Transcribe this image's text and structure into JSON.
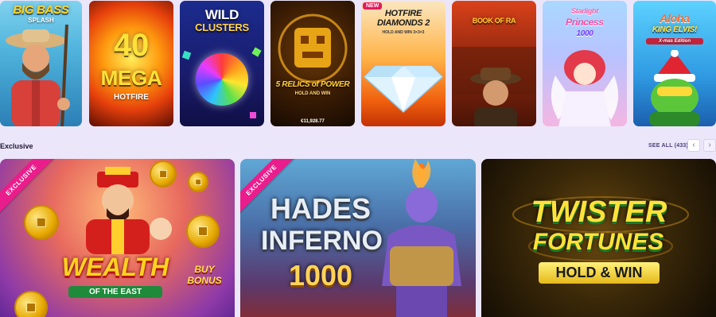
{
  "top_games": [
    {
      "title": "BIG BASS",
      "subtitle": "SPLASH",
      "icon": "fisherman-icon"
    },
    {
      "title": "40",
      "subtitle": "MEGA",
      "extra": "HOTFIRE",
      "icon": "fire-icon"
    },
    {
      "title": "WILD",
      "subtitle": "CLUSTERS",
      "icon": "color-wheel-icon"
    },
    {
      "title": "5 RELICS of POWER",
      "subtitle": "HOLD AND WIN",
      "jackpot": "€11,928.77",
      "icon": "idol-icon"
    },
    {
      "title": "HOTFIRE",
      "subtitle": "DIAMONDS 2",
      "extra": "HOLD AND WIN 3×3×3",
      "badge": "NEW",
      "icon": "diamond-icon"
    },
    {
      "title": "BOOK OF RA",
      "subtitle": "",
      "icon": "explorer-icon"
    },
    {
      "title": "Starlight",
      "subtitle": "Princess",
      "extra": "1000",
      "icon": "princess-icon"
    },
    {
      "title": "Aloha",
      "subtitle": "KING ELVIS!",
      "extra": "X-mas Edition",
      "icon": "frog-icon"
    }
  ],
  "section": {
    "title": "Exclusive",
    "see_all": "SEE ALL (433)",
    "prev": "‹",
    "next": "›"
  },
  "exclusive_games": [
    {
      "badge": "EXCLUSIVE",
      "title": "WEALTH",
      "subtitle": "OF THE EAST",
      "extra": "BUY BONUS"
    },
    {
      "badge": "EXCLUSIVE",
      "title": "HADES",
      "subtitle": "INFERNO",
      "extra": "1000"
    },
    {
      "title": "TWISTER",
      "subtitle": "FORTUNES",
      "extra": "HOLD & WIN"
    }
  ]
}
